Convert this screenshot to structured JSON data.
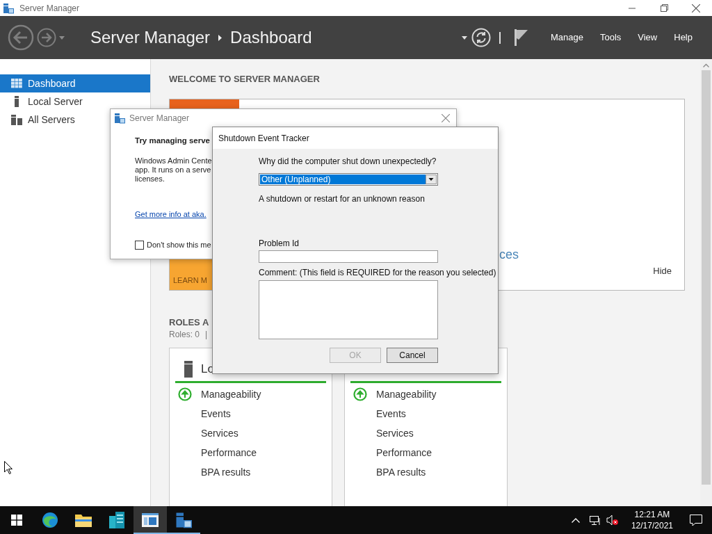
{
  "window": {
    "title": "Server Manager"
  },
  "header": {
    "breadcrumb": [
      "Server Manager",
      "Dashboard"
    ],
    "menu": [
      "Manage",
      "Tools",
      "View",
      "Help"
    ]
  },
  "sidebar": {
    "items": [
      {
        "label": "Dashboard",
        "kind": "dashboard",
        "selected": true
      },
      {
        "label": "Local Server",
        "kind": "server",
        "selected": false
      },
      {
        "label": "All Servers",
        "kind": "servers",
        "selected": false
      }
    ]
  },
  "welcome": {
    "heading": "WELCOME TO SERVER MANAGER",
    "link_fragment": "ces",
    "learn_more": "LEARN M",
    "hide": "Hide"
  },
  "roles": {
    "heading": "ROLES A",
    "count": "Roles: 0",
    "divider": "|"
  },
  "server_tiles": [
    {
      "title": "Lo",
      "items": [
        {
          "label": "Manageability",
          "status_ok": true
        },
        {
          "label": "Events",
          "status_ok": false
        },
        {
          "label": "Services",
          "status_ok": false
        },
        {
          "label": "Performance",
          "status_ok": false
        },
        {
          "label": "BPA results",
          "status_ok": false
        }
      ]
    },
    {
      "items": [
        {
          "label": "Manageability",
          "status_ok": true
        },
        {
          "label": "Events",
          "status_ok": false
        },
        {
          "label": "Services",
          "status_ok": false
        },
        {
          "label": "Performance",
          "status_ok": false
        },
        {
          "label": "BPA results",
          "status_ok": false
        }
      ]
    }
  ],
  "notice_dialog": {
    "title": "Server Manager",
    "heading": "Try managing serve",
    "body_lines": [
      "Windows Admin Cente",
      "app. It runs on a serve",
      "licenses."
    ],
    "link": "Get more info at aka.",
    "checkbox": {
      "label": "Don't show this me",
      "checked": false
    }
  },
  "tracker_dialog": {
    "title": "Shutdown Event Tracker",
    "question": "Why did the computer shut down unexpectedly?",
    "reason": {
      "value": "Other (Unplanned)"
    },
    "reason_description": "A shutdown or restart for an unknown reason",
    "problem_id": {
      "label": "Problem Id"
    },
    "comment": {
      "label": "Comment: (This field is REQUIRED for the reason you selected)"
    },
    "buttons": [
      {
        "label": "OK",
        "disabled": true
      },
      {
        "label": "Cancel",
        "disabled": false
      }
    ]
  },
  "taskbar": {
    "apps": [
      {
        "kind": "browser",
        "running": false,
        "selected": false
      },
      {
        "kind": "folder",
        "running": false,
        "selected": false
      },
      {
        "kind": "building",
        "running": false,
        "selected": false
      },
      {
        "kind": "window",
        "running": true,
        "selected": true
      },
      {
        "kind": "server",
        "running": true,
        "selected": false
      }
    ],
    "time": "12:21 AM",
    "date": "12/17/2021"
  }
}
